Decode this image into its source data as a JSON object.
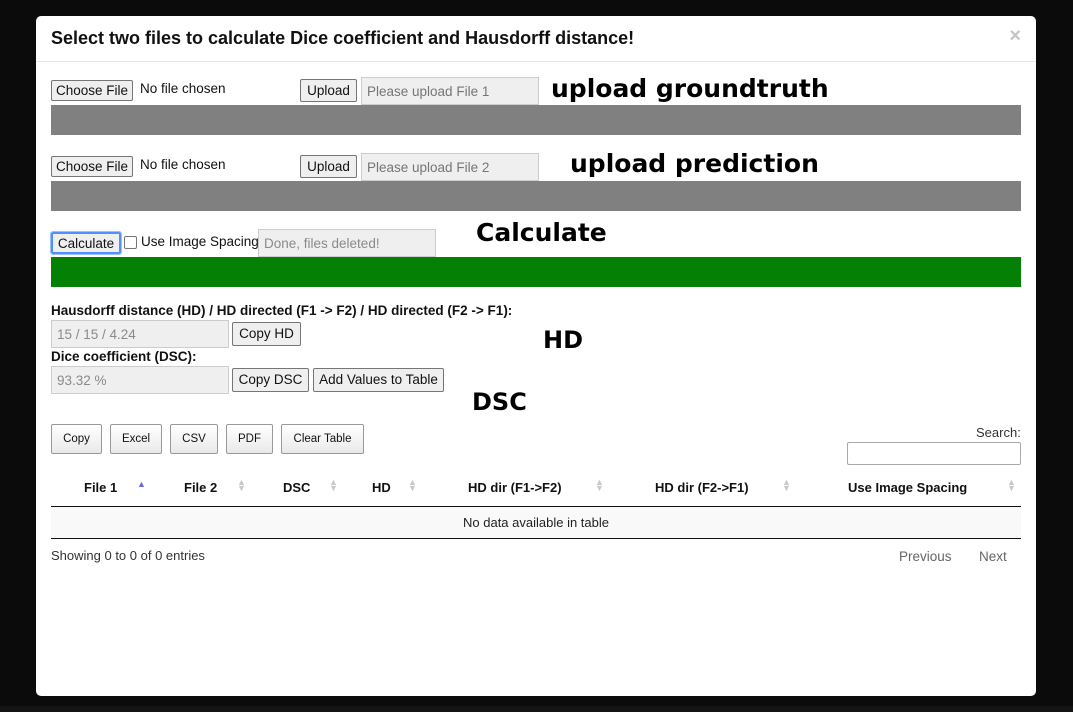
{
  "modal": {
    "title": "Select two files to calculate Dice coefficient and Hausdorff distance!",
    "close_label": "×"
  },
  "file1": {
    "choose_label": "Choose File",
    "status": "No file chosen",
    "upload_label": "Upload",
    "placeholder": "Please upload File 1",
    "annotation": "upload groundtruth",
    "progress_color": "#808080"
  },
  "file2": {
    "choose_label": "Choose File",
    "status": "No file chosen",
    "upload_label": "Upload",
    "placeholder": "Please upload File 2",
    "annotation": "upload prediction",
    "progress_color": "#808080"
  },
  "calculate": {
    "button_label": "Calculate",
    "checkbox_label": "Use Image Spacing",
    "checkbox_checked": false,
    "status_value": "Done, files deleted!",
    "annotation": "Calculate",
    "progress_color": "#048104"
  },
  "results": {
    "hd_label": "Hausdorff distance (HD) / HD directed (F1 -> F2) / HD directed (F2 -> F1):",
    "hd_value": "15 / 15 / 4.24",
    "copy_hd_label": "Copy HD",
    "hd_annotation": "HD",
    "dsc_label": "Dice coefficient (DSC):",
    "dsc_value": "93.32 %",
    "copy_dsc_label": "Copy DSC",
    "add_values_label": "Add Values to Table",
    "dsc_annotation": "DSC"
  },
  "table_tools": {
    "buttons": [
      "Copy",
      "Excel",
      "CSV",
      "PDF",
      "Clear Table"
    ],
    "search_label": "Search:",
    "search_value": ""
  },
  "table": {
    "columns": [
      "File 1",
      "File 2",
      "DSC",
      "HD",
      "HD dir (F1->F2)",
      "HD dir (F2->F1)",
      "Use Image Spacing"
    ],
    "sorted_column": "File 1",
    "empty_message": "No data available in table",
    "info": "Showing 0 to 0 of 0 entries",
    "previous_label": "Previous",
    "next_label": "Next"
  }
}
